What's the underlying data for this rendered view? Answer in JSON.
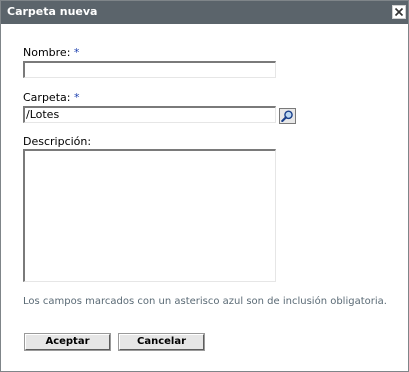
{
  "dialog": {
    "title": "Carpeta nueva",
    "close_icon": "close-icon"
  },
  "form": {
    "nombre": {
      "label": "Nombre:",
      "required_mark": "*",
      "value": ""
    },
    "carpeta": {
      "label": "Carpeta:",
      "required_mark": "*",
      "value": "/Lotes",
      "browse_icon": "magnifier-icon"
    },
    "descripcion": {
      "label": "Descripción:",
      "value": ""
    },
    "required_note": "Los campos marcados con un asterisco azul son de inclusión obligatoria."
  },
  "buttons": {
    "accept_label": "Aceptar",
    "cancel_label": "Cancelar"
  },
  "colors": {
    "titlebar": "#5b646b",
    "required_asterisk": "#1b3fae",
    "note_text": "#5a6a75"
  }
}
